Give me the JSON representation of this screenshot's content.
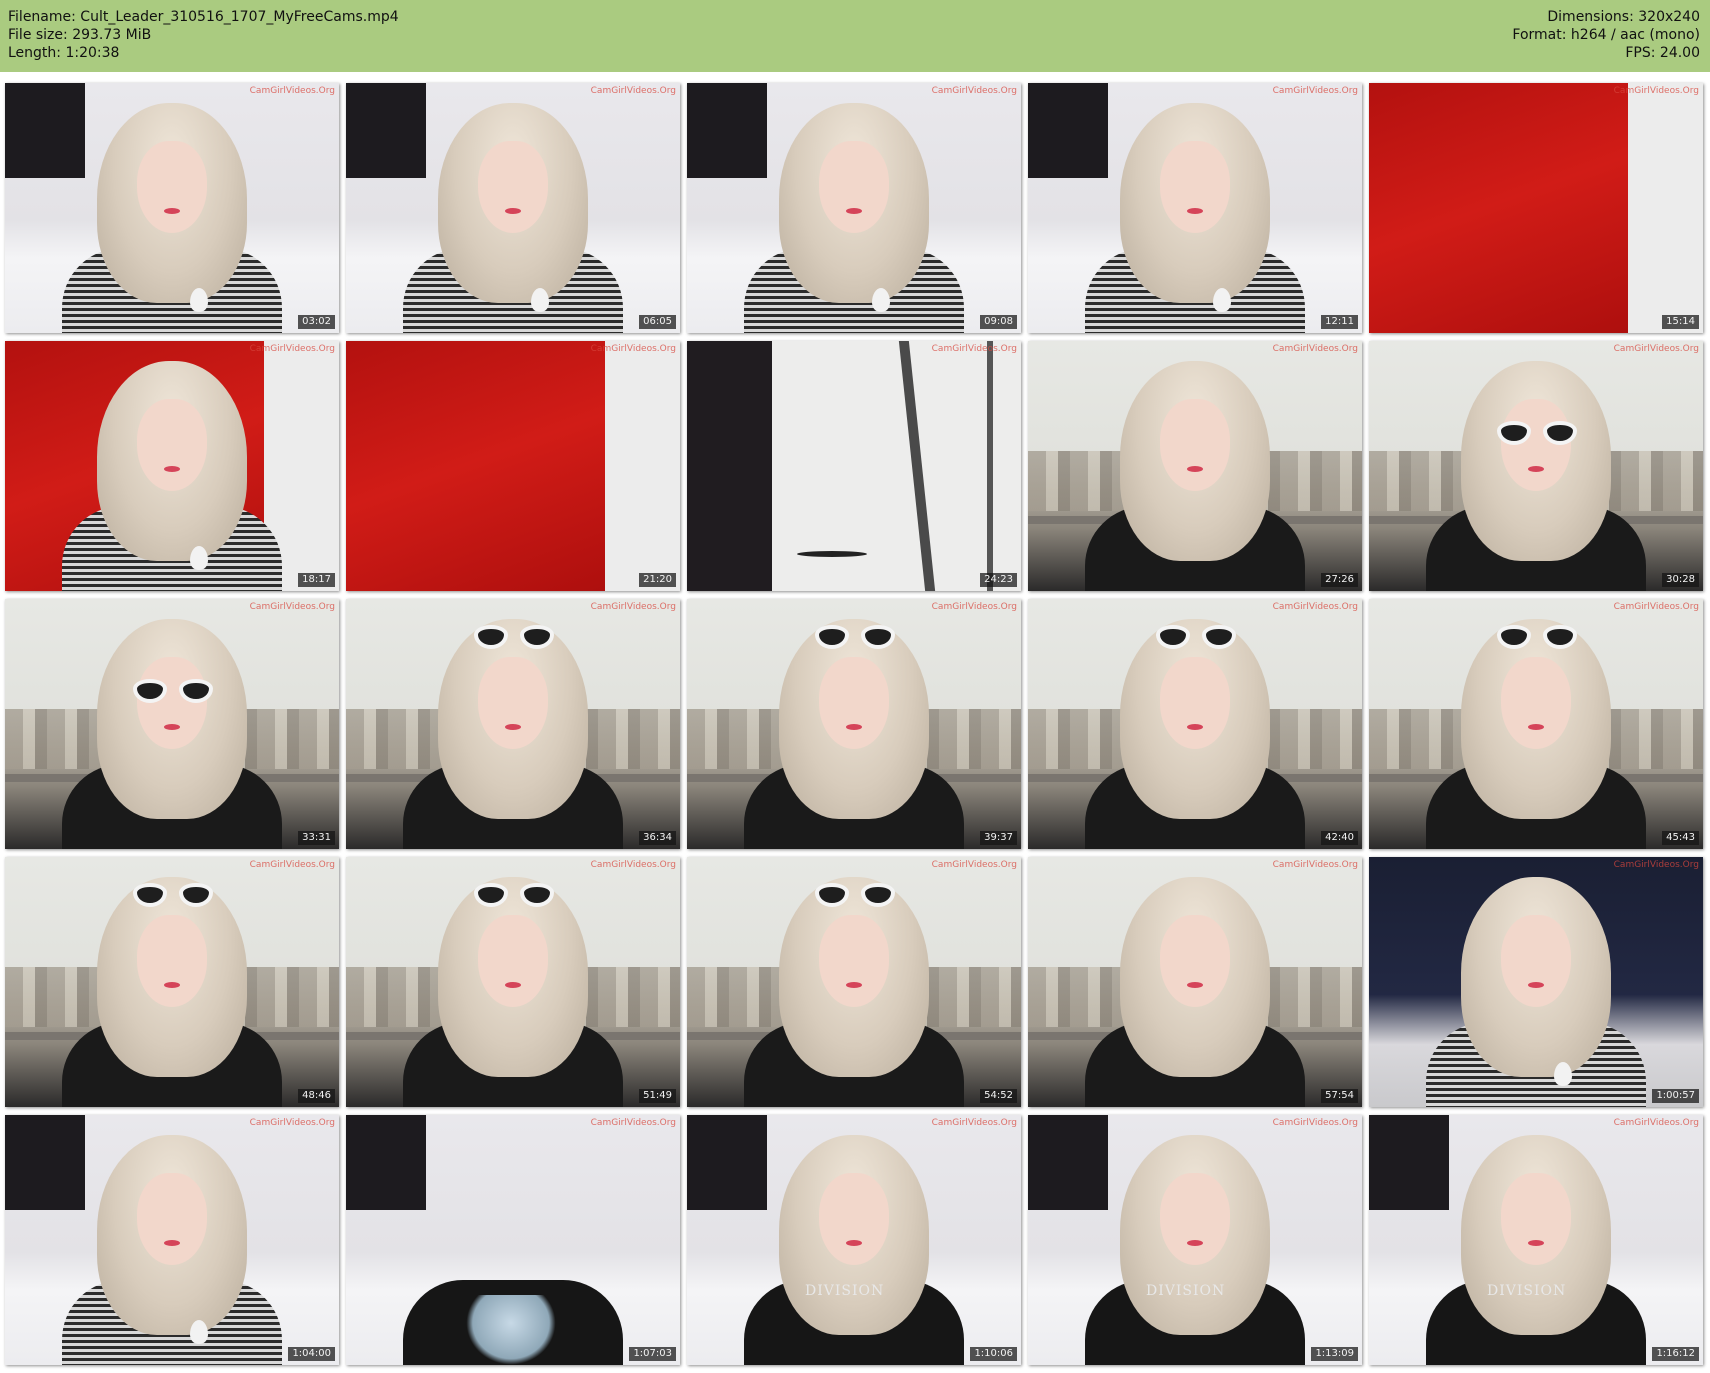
{
  "header": {
    "filename_label": "Filename: Cult_Leader_310516_1707_MyFreeCams.mp4",
    "filesize_label": "File size: 293.73 MiB",
    "length_label": "Length: 1:20:38",
    "dimensions_label": "Dimensions: 320x240",
    "format_label": "Format: h264 / aac (mono)",
    "fps_label": "FPS: 24.00"
  },
  "colors": {
    "header_background": "#aacb80",
    "timestamp_background": "#141414",
    "watermark": "#d8473e"
  },
  "thumbnails": [
    {
      "time": "03:02",
      "scene": "bedroom",
      "shirt": "stripe",
      "watermark": "CamGirlVideos.Org"
    },
    {
      "time": "06:05",
      "scene": "bedroom",
      "shirt": "stripe",
      "watermark": "CamGirlVideos.Org"
    },
    {
      "time": "09:08",
      "scene": "bedroom",
      "shirt": "stripe",
      "watermark": "CamGirlVideos.Org"
    },
    {
      "time": "12:11",
      "scene": "bedroom",
      "shirt": "stripe",
      "watermark": "CamGirlVideos.Org"
    },
    {
      "time": "15:14",
      "scene": "red",
      "shirt": "none",
      "watermark": "CamGirlVideos.Org"
    },
    {
      "time": "18:17",
      "scene": "red",
      "shirt": "stripe",
      "watermark": "CamGirlVideos.Org"
    },
    {
      "time": "21:20",
      "scene": "red",
      "shirt": "none",
      "watermark": "CamGirlVideos.Org"
    },
    {
      "time": "24:23",
      "scene": "window",
      "shirt": "none",
      "watermark": "CamGirlVideos.Org"
    },
    {
      "time": "27:26",
      "scene": "city",
      "shirt": "black",
      "watermark": "CamGirlVideos.Org"
    },
    {
      "time": "30:28",
      "scene": "city",
      "shirt": "black",
      "glasses": "on",
      "watermark": "CamGirlVideos.Org"
    },
    {
      "time": "33:31",
      "scene": "city",
      "shirt": "black",
      "glasses": "on",
      "watermark": "CamGirlVideos.Org"
    },
    {
      "time": "36:34",
      "scene": "city",
      "shirt": "black",
      "glasses": "up",
      "watermark": "CamGirlVideos.Org"
    },
    {
      "time": "39:37",
      "scene": "city",
      "shirt": "black",
      "glasses": "up",
      "watermark": "CamGirlVideos.Org"
    },
    {
      "time": "42:40",
      "scene": "city",
      "shirt": "black",
      "glasses": "up",
      "watermark": "CamGirlVideos.Org"
    },
    {
      "time": "45:43",
      "scene": "city",
      "shirt": "black",
      "glasses": "up",
      "watermark": "CamGirlVideos.Org"
    },
    {
      "time": "48:46",
      "scene": "city",
      "shirt": "black",
      "glasses": "up",
      "watermark": "CamGirlVideos.Org"
    },
    {
      "time": "51:49",
      "scene": "city",
      "shirt": "black",
      "glasses": "up",
      "watermark": "CamGirlVideos.Org"
    },
    {
      "time": "54:52",
      "scene": "city",
      "shirt": "black",
      "glasses": "up",
      "watermark": "CamGirlVideos.Org"
    },
    {
      "time": "57:54",
      "scene": "city",
      "shirt": "black",
      "watermark": "CamGirlVideos.Org"
    },
    {
      "time": "1:00:57",
      "scene": "curtain",
      "shirt": "stripe",
      "watermark": "CamGirlVideos.Org"
    },
    {
      "time": "1:04:00",
      "scene": "bedroom",
      "shirt": "stripe",
      "watermark": "CamGirlVideos.Org"
    },
    {
      "time": "1:07:03",
      "scene": "bedroom",
      "shirt": "tee-print",
      "watermark": "CamGirlVideos.Org"
    },
    {
      "time": "1:10:06",
      "scene": "bedroom",
      "shirt": "tee",
      "tee_text": "DIVISION",
      "watermark": "CamGirlVideos.Org"
    },
    {
      "time": "1:13:09",
      "scene": "bedroom",
      "shirt": "tee",
      "tee_text": "DIVISION",
      "watermark": "CamGirlVideos.Org"
    },
    {
      "time": "1:16:12",
      "scene": "bedroom",
      "shirt": "tee",
      "tee_text": "DIVISION",
      "watermark": "CamGirlVideos.Org"
    }
  ]
}
